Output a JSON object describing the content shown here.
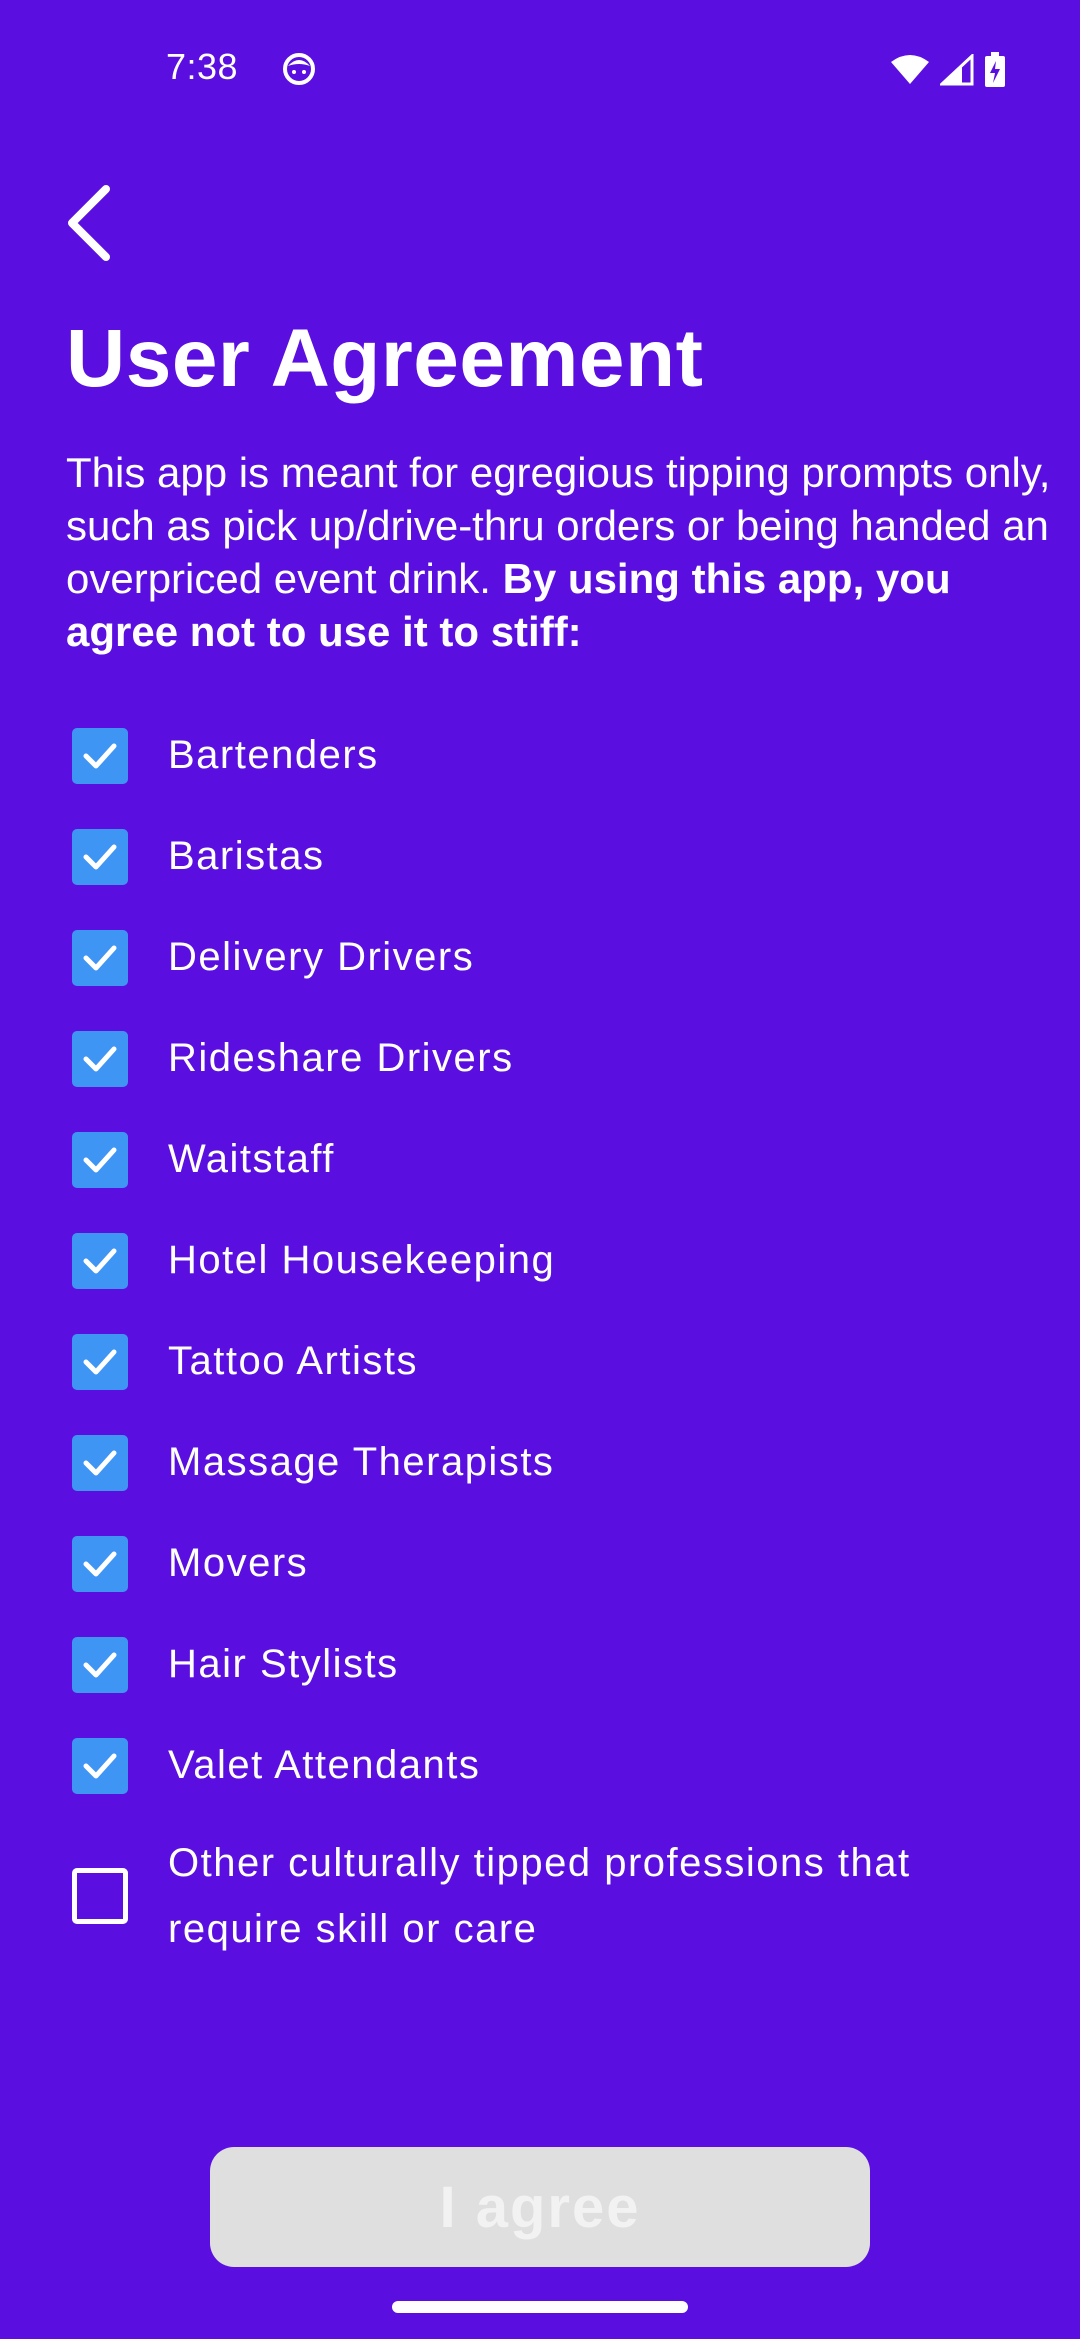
{
  "status_bar": {
    "time": "7:38",
    "icons": [
      "face-icon",
      "wifi-icon",
      "signal-icon",
      "battery-charging-icon"
    ]
  },
  "header": {
    "back_icon": "chevron-left-icon",
    "title": "User Agreement"
  },
  "intro": {
    "text": "This app is meant for egregious tipping prompts only, such as pick up/drive-thru orders or being handed an overpriced event drink. ",
    "emphasis": "By using this app, you agree not to use it to stiff:"
  },
  "professions": [
    {
      "label": "Bartenders",
      "checked": true
    },
    {
      "label": "Baristas",
      "checked": true
    },
    {
      "label": "Delivery Drivers",
      "checked": true
    },
    {
      "label": "Rideshare Drivers",
      "checked": true
    },
    {
      "label": "Waitstaff",
      "checked": true
    },
    {
      "label": "Hotel Housekeeping",
      "checked": true
    },
    {
      "label": "Tattoo Artists",
      "checked": true
    },
    {
      "label": "Massage Therapists",
      "checked": true
    },
    {
      "label": "Movers",
      "checked": true
    },
    {
      "label": "Hair Stylists",
      "checked": true
    },
    {
      "label": "Valet Attendants",
      "checked": true
    },
    {
      "label": "Other culturally tipped professions that require skill or care",
      "checked": false
    }
  ],
  "agree_button": {
    "label": "I agree",
    "enabled": false
  },
  "colors": {
    "background": "#5a0fe0",
    "checkbox_checked": "#3f95f4",
    "button_disabled": "#dfdfdf",
    "text": "#ffffff"
  }
}
